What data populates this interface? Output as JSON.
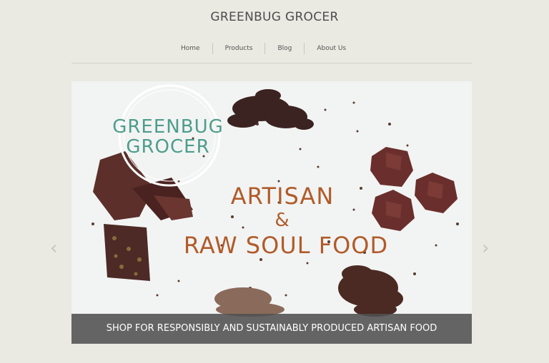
{
  "site": {
    "title": "GREENBUG GROCER"
  },
  "nav": {
    "items": [
      {
        "label": "Home"
      },
      {
        "label": "Products"
      },
      {
        "label": "Blog"
      },
      {
        "label": "About Us"
      }
    ]
  },
  "slider": {
    "logo_line1": "GREENBUG",
    "logo_line2": "GROCER",
    "headline_line1": "ARTISAN",
    "headline_line2": "&",
    "headline_line3": "RAW SOUL FOOD",
    "caption": "SHOP FOR RESPONSIBLY AND SUSTAINABLY PRODUCED ARTISAN FOOD",
    "prev_icon": "‹",
    "next_icon": "›"
  },
  "colors": {
    "page_bg": "#eae9e2",
    "logo_teal": "#4e9d8c",
    "headline_brown": "#b15b2a",
    "caption_bg": "#505050"
  }
}
